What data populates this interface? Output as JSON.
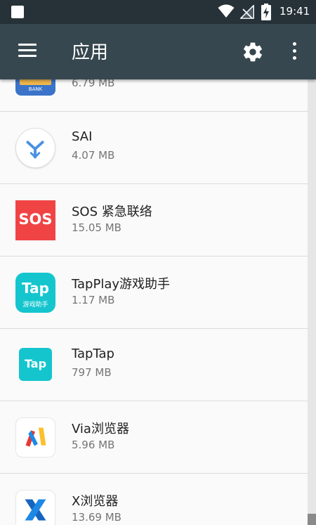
{
  "status_bar": {
    "time": "19:41",
    "icons": [
      "notification-icon",
      "wifi-icon",
      "no-signal-icon",
      "battery-charging-icon"
    ]
  },
  "app_bar": {
    "title": "应用",
    "menu_icon": "hamburger-menu-icon",
    "settings_icon": "gear-icon",
    "more_icon": "more-vert-icon"
  },
  "apps": [
    {
      "name": "",
      "size": "6.79 MB",
      "icon": "bank-app-icon",
      "icon_label": "BANK"
    },
    {
      "name": "SAI",
      "size": "4.07 MB",
      "icon": "sai-split-icon"
    },
    {
      "name": "SOS 紧急联络",
      "size": "15.05 MB",
      "icon": "sos-icon",
      "icon_label": "SOS"
    },
    {
      "name": "TapPlay游戏助手",
      "size": "1.17 MB",
      "icon": "tapplay-icon",
      "icon_label": "Tap",
      "icon_sublabel": "游戏助手"
    },
    {
      "name": "TapTap",
      "size": "797 MB",
      "icon": "taptap-icon",
      "icon_label": "Tap"
    },
    {
      "name": "Via浏览器",
      "size": "5.96 MB",
      "icon": "via-browser-icon"
    },
    {
      "name": "X浏览器",
      "size": "13.69 MB",
      "icon": "x-browser-icon"
    }
  ],
  "scrollbar": {
    "position_fraction": 0.97
  },
  "colors": {
    "status_bar": "#263238",
    "app_bar": "#37474f",
    "list_bg": "#fafafa",
    "divider": "#dcdcdc",
    "sos_red": "#f04444",
    "tap_cyan": "#15c5ce"
  }
}
